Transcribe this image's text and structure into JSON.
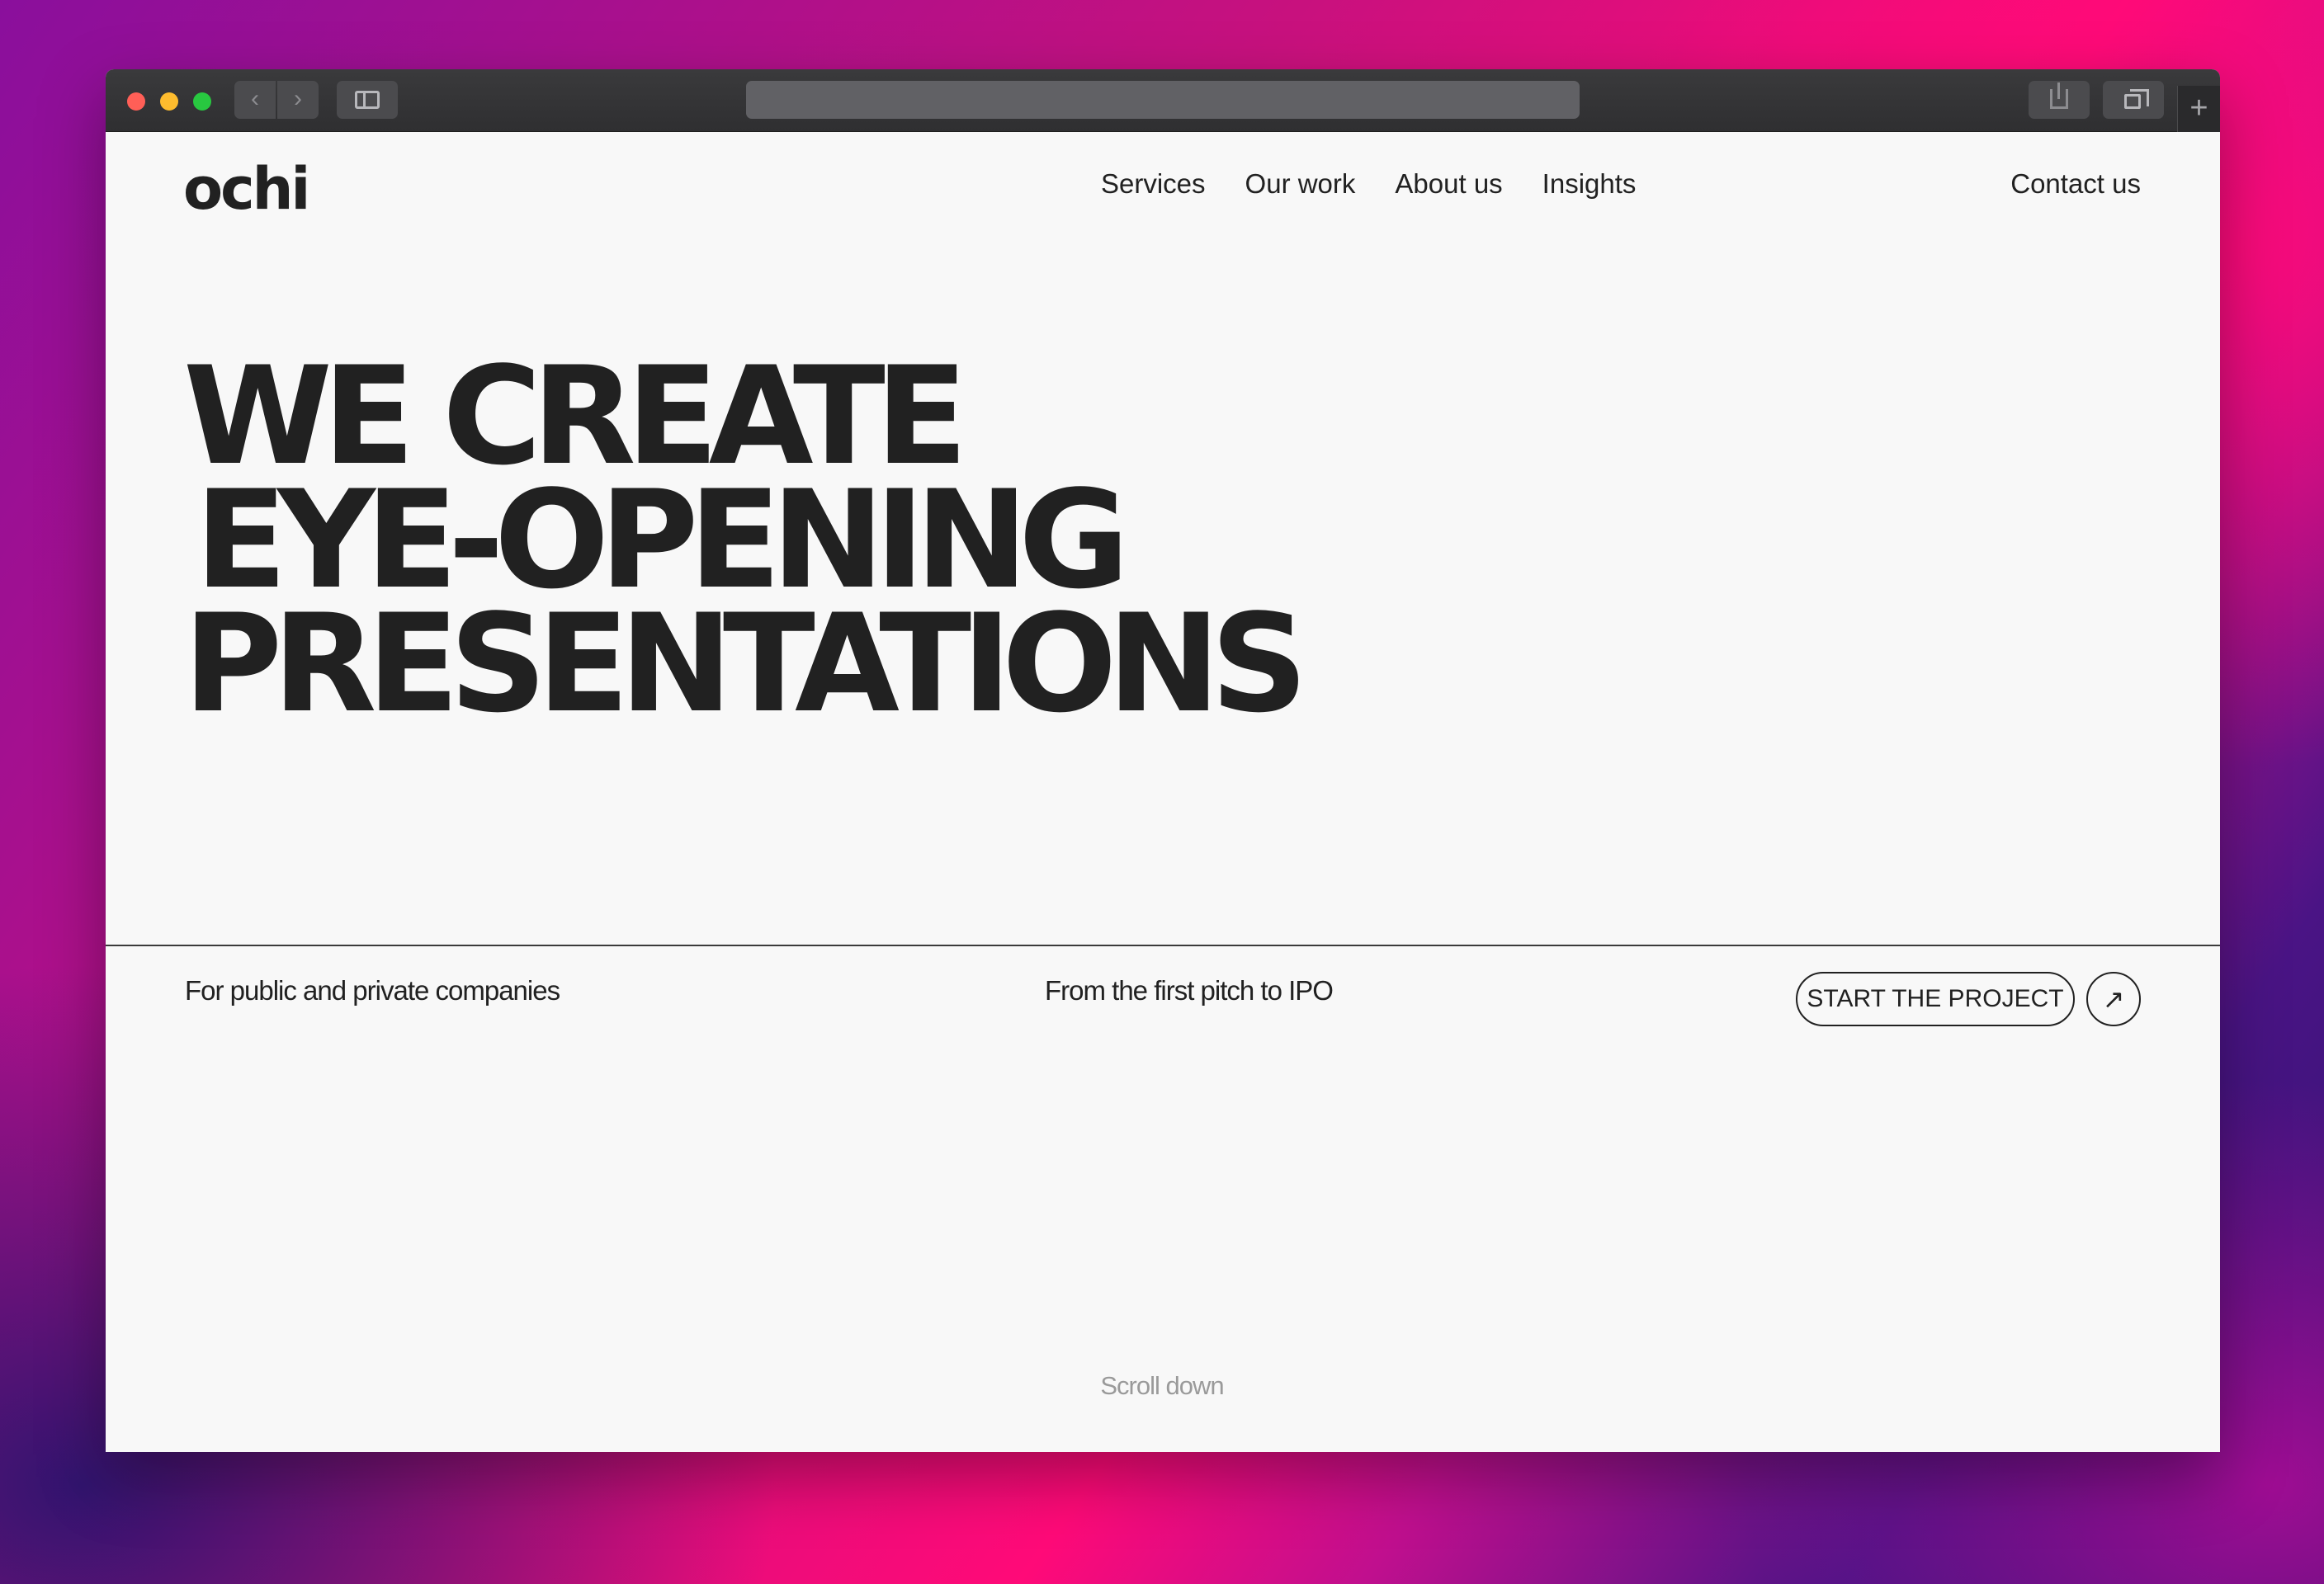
{
  "nav": {
    "logo": "ochi",
    "items": [
      {
        "label": "Services"
      },
      {
        "label": "Our work"
      },
      {
        "label": "About us"
      },
      {
        "label": "Insights"
      }
    ],
    "contact": "Contact us"
  },
  "hero": {
    "lines": [
      "WE CREATE",
      "EYE-OPENING",
      "PRESENTATIONS"
    ]
  },
  "bottom": {
    "tagline_1": "For public and private companies",
    "tagline_2": "From the first pitch to IPO",
    "cta_label": "START THE PROJECT",
    "cta_icon": "↗",
    "scroll_label": "Scroll down"
  },
  "browser": {
    "back_icon": "‹",
    "forward_icon": "›",
    "new_tab_icon": "+"
  }
}
